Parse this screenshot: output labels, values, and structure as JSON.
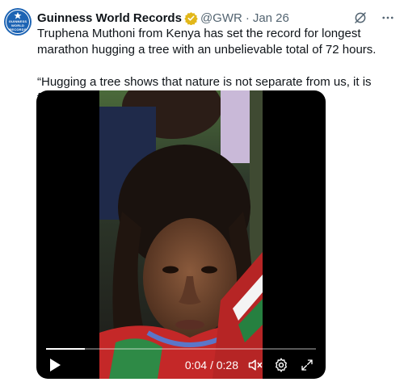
{
  "tweet": {
    "author": {
      "name": "Guinness World Records",
      "handle": "@GWR",
      "verified": true,
      "avatar_icon": "gwr-logo",
      "avatar_text": "GUINNESS WORLD RECORDS"
    },
    "separator": "·",
    "date": "Jan 26",
    "text_line_1": "Truphena Muthoni from Kenya has set the record for longest marathon hugging a tree with an unbelievable total of 72 hours.",
    "text_line_2": "“Hugging a tree shows that nature is not separate from us, it is family.\""
  },
  "video": {
    "current_time": "0:04",
    "duration": "0:28",
    "time_display": "0:04 / 0:28",
    "progress": 0.143,
    "controls": [
      "play-icon",
      "volume-icon",
      "settings-icon",
      "fullscreen-icon"
    ]
  },
  "colors": {
    "text_primary": "#0f1419",
    "text_secondary": "#536471",
    "verified_gold": "#e2b719",
    "brand_blue": "#1d64b4"
  }
}
